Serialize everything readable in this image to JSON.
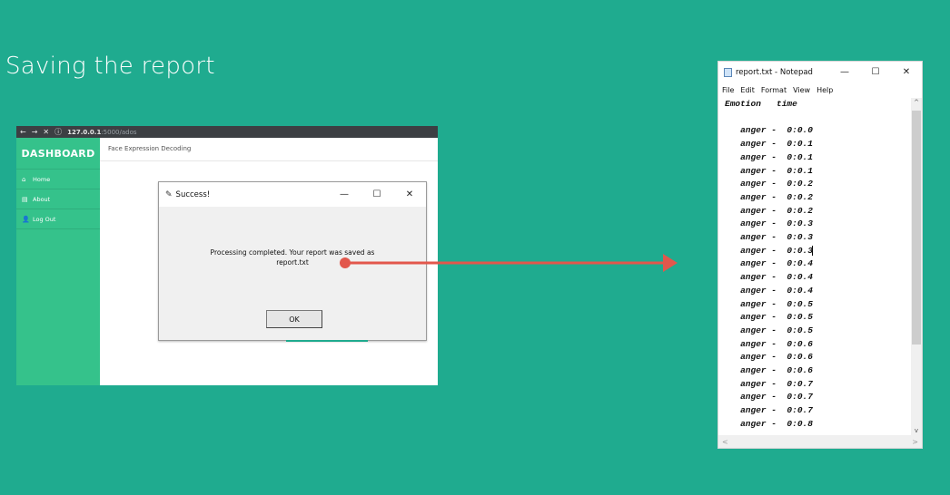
{
  "slide": {
    "title": "Saving the report"
  },
  "browser": {
    "nav_back": "←",
    "nav_forward": "→",
    "nav_close": "✕",
    "info_icon": "ⓘ",
    "url_host": "127.0.0.1",
    "url_rest": ":5000/ados",
    "sidebar": {
      "brand": "DASHBOARD",
      "items": [
        {
          "icon": "home-icon",
          "glyph": "⌂",
          "label": "Home"
        },
        {
          "icon": "about-card-icon",
          "glyph": "▤",
          "label": "About"
        },
        {
          "icon": "user-icon",
          "glyph": "👤",
          "label": "Log Out"
        }
      ]
    },
    "header_text": "Face Expression Decoding"
  },
  "dialog": {
    "title": "Success!",
    "minimize": "—",
    "maximize": "☐",
    "close": "✕",
    "message_line1": "Processing completed. Your report was saved as",
    "message_line2": "report.txt",
    "ok_label": "OK"
  },
  "notepad": {
    "title": "report.txt - Notepad",
    "minimize": "—",
    "maximize": "☐",
    "close": "✕",
    "menu": [
      "File",
      "Edit",
      "Format",
      "View",
      "Help"
    ],
    "header_line": "Emotion   time",
    "rows": [
      {
        "emotion": "anger",
        "time": "0:0.0"
      },
      {
        "emotion": "anger",
        "time": "0:0.1"
      },
      {
        "emotion": "anger",
        "time": "0:0.1"
      },
      {
        "emotion": "anger",
        "time": "0:0.1"
      },
      {
        "emotion": "anger",
        "time": "0:0.2"
      },
      {
        "emotion": "anger",
        "time": "0:0.2"
      },
      {
        "emotion": "anger",
        "time": "0:0.2"
      },
      {
        "emotion": "anger",
        "time": "0:0.3"
      },
      {
        "emotion": "anger",
        "time": "0:0.3"
      },
      {
        "emotion": "anger",
        "time": "0:0.3"
      },
      {
        "emotion": "anger",
        "time": "0:0.4"
      },
      {
        "emotion": "anger",
        "time": "0:0.4"
      },
      {
        "emotion": "anger",
        "time": "0:0.4"
      },
      {
        "emotion": "anger",
        "time": "0:0.5"
      },
      {
        "emotion": "anger",
        "time": "0:0.5"
      },
      {
        "emotion": "anger",
        "time": "0:0.5"
      },
      {
        "emotion": "anger",
        "time": "0:0.6"
      },
      {
        "emotion": "anger",
        "time": "0:0.6"
      },
      {
        "emotion": "anger",
        "time": "0:0.6"
      },
      {
        "emotion": "anger",
        "time": "0:0.7"
      },
      {
        "emotion": "anger",
        "time": "0:0.7"
      },
      {
        "emotion": "anger",
        "time": "0:0.7"
      },
      {
        "emotion": "anger",
        "time": "0:0.8"
      }
    ],
    "scroll_up": "^",
    "scroll_down": "v",
    "scroll_left": "<",
    "scroll_right": ">"
  },
  "colors": {
    "background": "#1fab8f",
    "sidebar": "#35c28b",
    "arrow": "#e2574c"
  }
}
